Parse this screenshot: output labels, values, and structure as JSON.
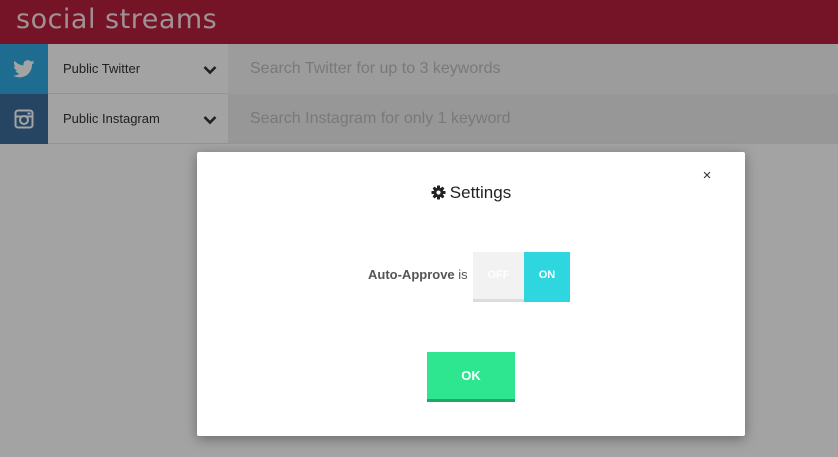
{
  "app": {
    "logo_text": "social streams",
    "brand_color": "#b81f3e"
  },
  "streams": [
    {
      "service": "Public Twitter",
      "icon": "twitter-icon",
      "icon_color": "#2fa9e0",
      "search_placeholder": "Search Twitter for up to 3 keywords",
      "search_value": ""
    },
    {
      "service": "Public Instagram",
      "icon": "instagram-icon",
      "icon_color": "#3a6c9c",
      "search_placeholder": "Search Instagram for only 1 keyword",
      "search_value": ""
    }
  ],
  "modal": {
    "title": "Settings",
    "title_icon": "gear-icon",
    "close_label": "×",
    "auto_approve_label": "Auto-Approve",
    "auto_approve_is": "is",
    "toggle_off_label": "OFF",
    "toggle_on_label": "ON",
    "toggle_state": "ON",
    "toggle_on_color": "#2ed6e0",
    "ok_label": "OK",
    "ok_color": "#2ee68f"
  }
}
